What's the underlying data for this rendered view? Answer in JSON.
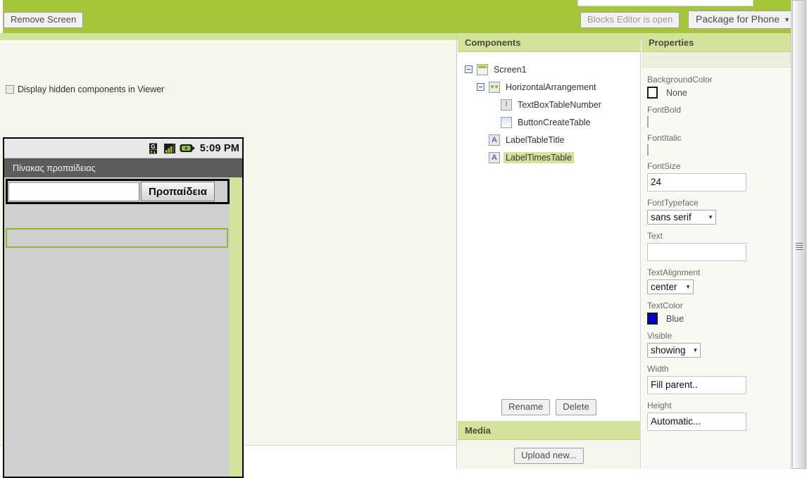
{
  "toolbar": {
    "remove_screen_label": "Remove Screen",
    "blocks_editor_label": "Blocks Editor is open",
    "package_phone_label": "Package for Phone",
    "package_phone_caret": "▼"
  },
  "viewer": {
    "hidden_components_label": "Display hidden components in Viewer",
    "hidden_components_checked": false,
    "phone": {
      "status_bar": {
        "time": "5:09 PM",
        "icons": [
          "data-transfer-icon",
          "signal-bars-icon",
          "battery-charging-icon"
        ]
      },
      "title_bar_text": "Πίνακας προπαίδειας",
      "textbox_value": "",
      "button_label": "Προπαίδεια"
    }
  },
  "components": {
    "header": "Components",
    "tree": [
      {
        "label": "Screen1",
        "icon": "screen-icon",
        "depth": 0,
        "toggle": "collapse",
        "selected": false
      },
      {
        "label": "HorizontalArrangement",
        "icon": "horizontal-arrangement-icon",
        "depth": 1,
        "toggle": "collapse",
        "selected": false
      },
      {
        "label": "TextBoxTableNumber",
        "icon": "textbox-icon",
        "depth": 2,
        "toggle": "none",
        "selected": false
      },
      {
        "label": "ButtonCreateTable",
        "icon": "button-icon",
        "depth": 2,
        "toggle": "none",
        "selected": false
      },
      {
        "label": "LabelTableTitle",
        "icon": "label-icon",
        "depth": 1,
        "toggle": "none",
        "selected": false
      },
      {
        "label": "LabelTimesTable",
        "icon": "label-icon",
        "depth": 1,
        "toggle": "none",
        "selected": true
      }
    ],
    "rename_label": "Rename",
    "delete_label": "Delete"
  },
  "media": {
    "header": "Media",
    "upload_label": "Upload new..."
  },
  "properties": {
    "header": "Properties",
    "selected_component": "",
    "items": [
      {
        "name": "BackgroundColor",
        "type": "color",
        "value": "None",
        "hex": "#ffffff"
      },
      {
        "name": "FontBold",
        "type": "checkbox",
        "value": false
      },
      {
        "name": "FontItalic",
        "type": "checkbox",
        "value": false
      },
      {
        "name": "FontSize",
        "type": "text",
        "value": "24"
      },
      {
        "name": "FontTypeface",
        "type": "select",
        "value": "sans serif"
      },
      {
        "name": "Text",
        "type": "text",
        "value": ""
      },
      {
        "name": "TextAlignment",
        "type": "select",
        "value": "center"
      },
      {
        "name": "TextColor",
        "type": "color",
        "value": "Blue",
        "hex": "#0000cc"
      },
      {
        "name": "Visible",
        "type": "select",
        "value": "showing"
      },
      {
        "name": "Width",
        "type": "text",
        "value": "Fill parent.."
      },
      {
        "name": "Height",
        "type": "text",
        "value": "Automatic..."
      }
    ]
  },
  "theme": {
    "green": "#a5c639",
    "light_green": "#d4e39c",
    "panel_bg": "#f5f7ed",
    "phone_gray": "#d0d0d0",
    "title_bar": "#5c5c5c"
  }
}
